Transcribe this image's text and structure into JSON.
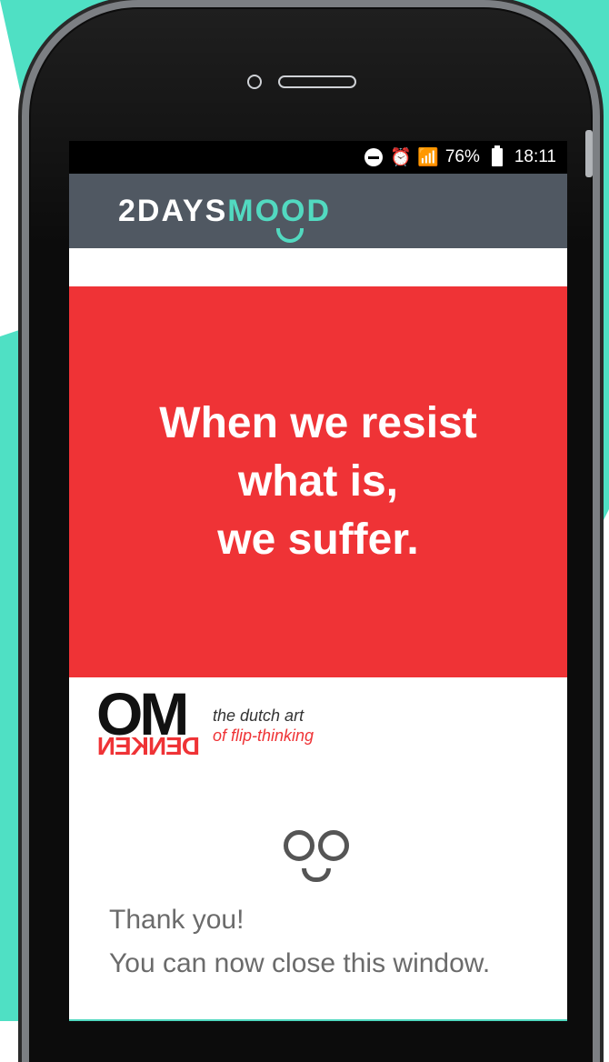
{
  "status_bar": {
    "battery_percent": "76%",
    "time": "18:11",
    "icons": [
      "do-not-disturb-icon",
      "alarm-icon",
      "wifi-icon",
      "signal-icon",
      "battery-icon"
    ]
  },
  "header": {
    "logo_part1": "2DAYS",
    "logo_part2": "MOOD"
  },
  "quote": {
    "lines": [
      "When we resist",
      "what is,",
      "we suffer."
    ]
  },
  "brand_block": {
    "om": "OM",
    "denken_flipped": "DENKEN",
    "tag_line1": "the dutch art",
    "tag_line2": "of flip-thinking"
  },
  "message": {
    "line1": "Thank you!",
    "line2": "You can now close this window."
  },
  "colors": {
    "teal": "#52d9c0",
    "red": "#ef3336",
    "header_gray": "#505862"
  }
}
